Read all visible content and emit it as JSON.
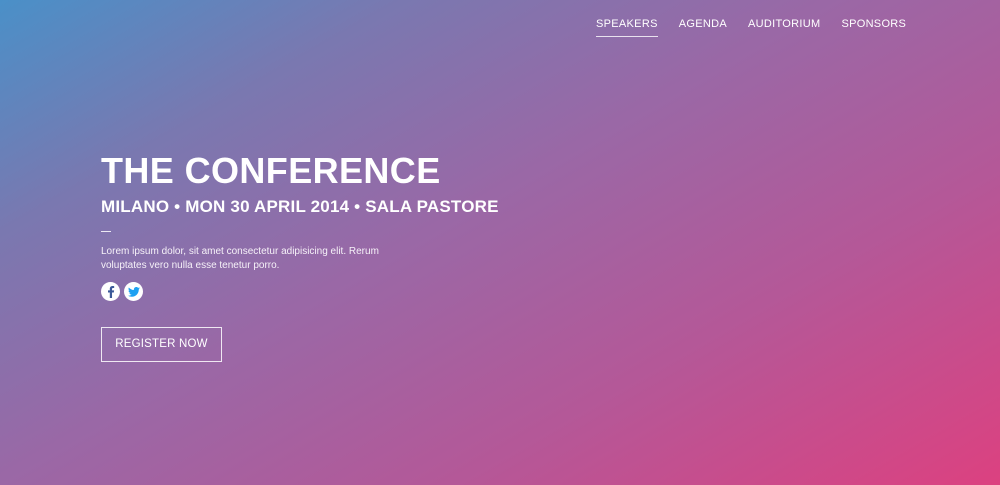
{
  "nav": {
    "items": [
      {
        "label": "SPEAKERS",
        "active": true
      },
      {
        "label": "AGENDA",
        "active": false
      },
      {
        "label": "AUDITORIUM",
        "active": false
      },
      {
        "label": "SPONSORS",
        "active": false
      }
    ]
  },
  "hero": {
    "title": "THE CONFERENCE",
    "subtitle": "MILANO • MON 30 APRIL 2014 • SALA PASTORE",
    "description": "Lorem ipsum dolor, sit amet consectetur adipisicing elit. Rerum voluptates vero nulla esse tenetur porro.",
    "register_label": "REGISTER NOW"
  },
  "social": [
    {
      "icon": "facebook-icon",
      "color": "#3b5998"
    },
    {
      "icon": "twitter-icon",
      "color": "#1da1f2"
    }
  ],
  "colors": {
    "gradient_start": "#4a90c8",
    "gradient_end": "#dc4180",
    "text": "#ffffff"
  }
}
